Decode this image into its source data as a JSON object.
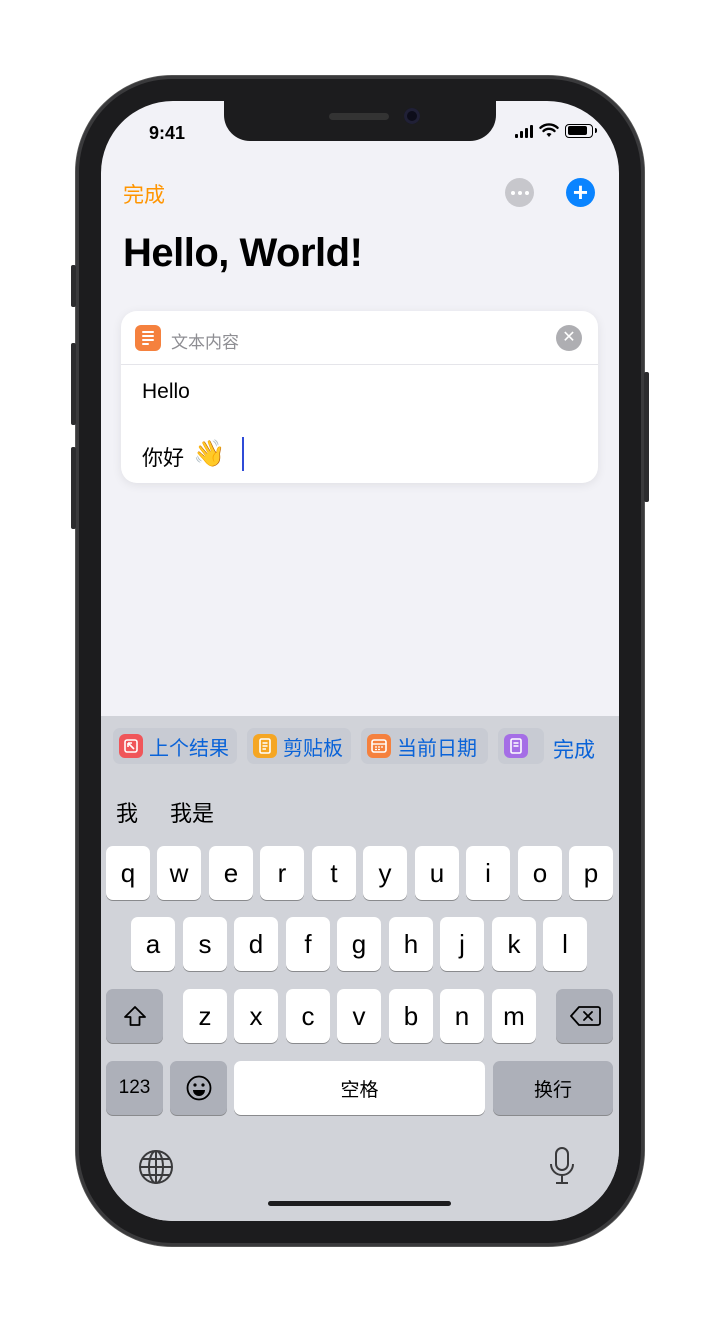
{
  "status": {
    "time": "9:41"
  },
  "nav": {
    "done_label": "完成"
  },
  "page": {
    "title": "Hello, World!"
  },
  "card": {
    "label": "文本内容",
    "lines": [
      "Hello",
      "你好"
    ],
    "emoji": "👋"
  },
  "suggestions": [
    {
      "label": "上个结果",
      "color": "#f0565a"
    },
    {
      "label": "剪贴板",
      "color": "#f5a623"
    },
    {
      "label": "当前日期",
      "color": "#f5813e"
    },
    {
      "label": "",
      "color": "#a56ee6"
    }
  ],
  "suggestion_done": "完成",
  "candidates": [
    "我",
    "我是"
  ],
  "keyboard": {
    "row1": [
      "q",
      "w",
      "e",
      "r",
      "t",
      "y",
      "u",
      "i",
      "o",
      "p"
    ],
    "row2": [
      "a",
      "s",
      "d",
      "f",
      "g",
      "h",
      "j",
      "k",
      "l"
    ],
    "row3": [
      "z",
      "x",
      "c",
      "v",
      "b",
      "n",
      "m"
    ],
    "numbers_label": "123",
    "space_label": "空格",
    "return_label": "换行"
  },
  "colors": {
    "accent_orange": "#ff9500",
    "accent_blue": "#0a84ff",
    "link_blue": "#0a63d8"
  }
}
